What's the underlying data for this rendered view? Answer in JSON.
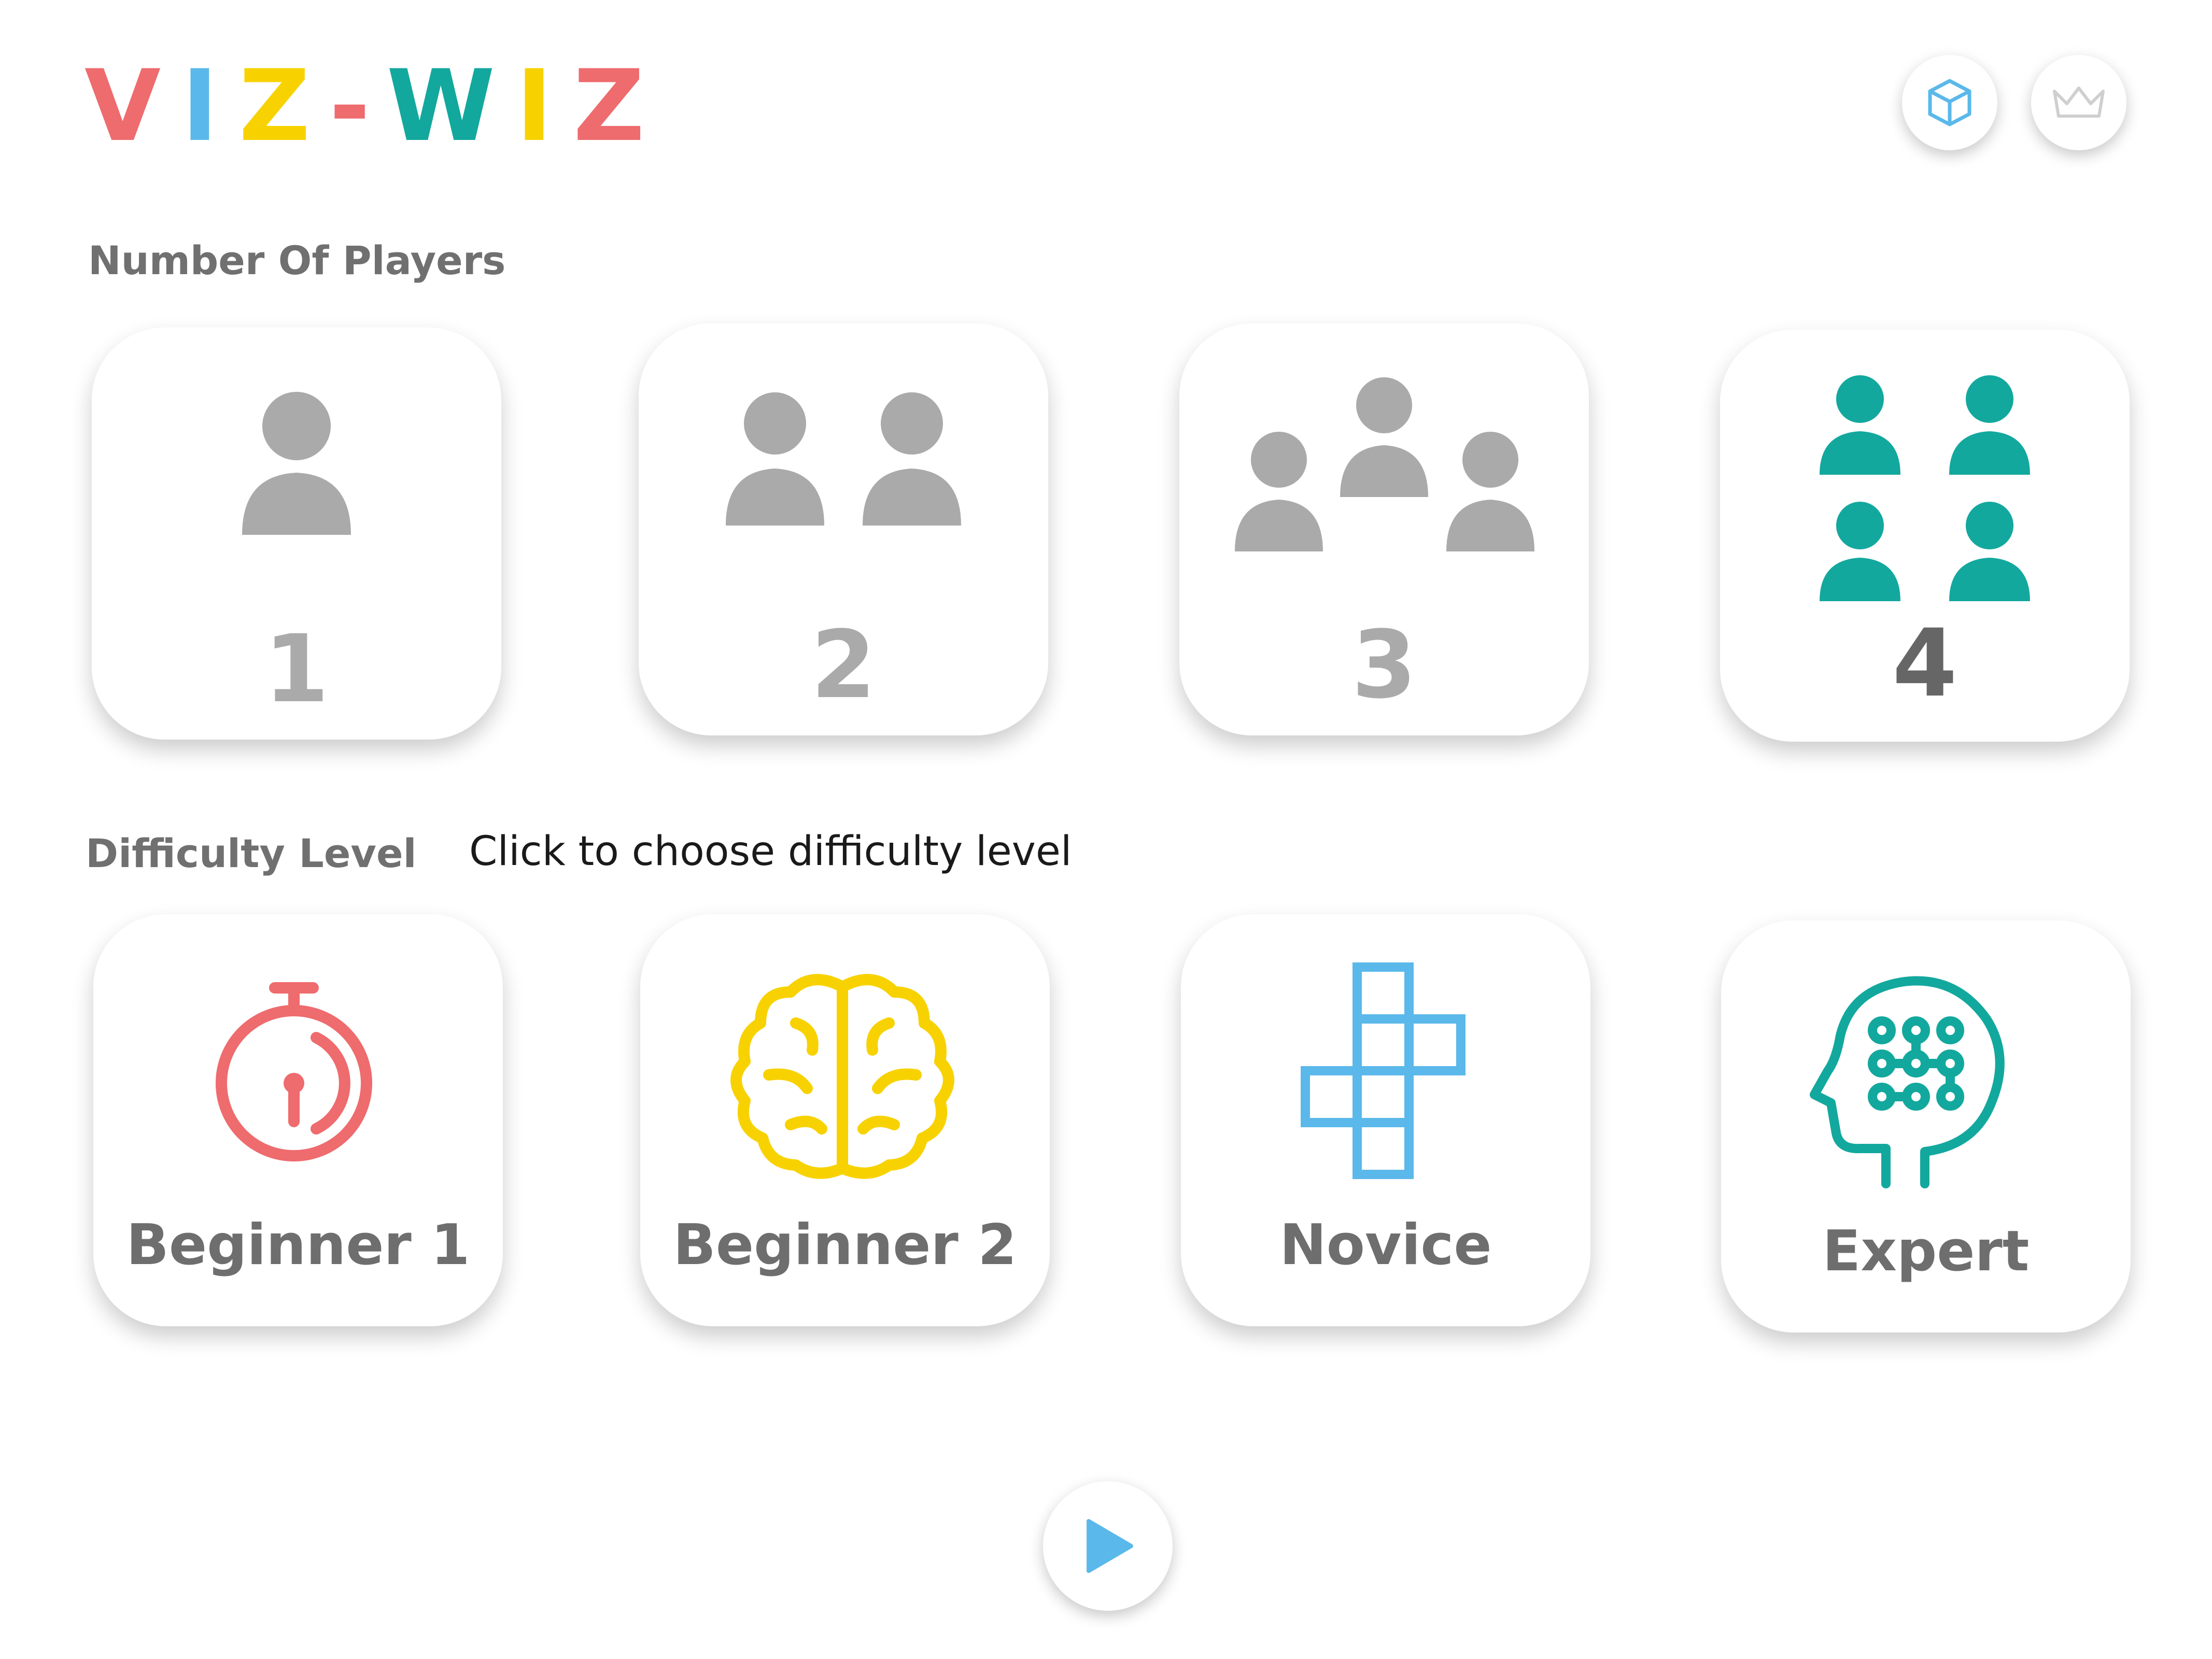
{
  "app": {
    "logo_letters": [
      "V",
      "I",
      "Z",
      "-",
      "W",
      "I",
      "Z"
    ],
    "logo_colors": [
      "#ee6b6e",
      "#5bb8ea",
      "#f7d200",
      "#ee6b6e",
      "#13a89e",
      "#f7d200",
      "#ee6b6e"
    ]
  },
  "header": {
    "cube_icon": "cube-icon",
    "crown_icon": "crown-icon"
  },
  "players": {
    "section_label": "Number Of Players",
    "options": [
      {
        "label": "1",
        "icon": "one-person-icon",
        "selected": false
      },
      {
        "label": "2",
        "icon": "two-people-icon",
        "selected": false
      },
      {
        "label": "3",
        "icon": "three-people-icon",
        "selected": false
      },
      {
        "label": "4",
        "icon": "four-people-icon",
        "selected": true
      }
    ]
  },
  "difficulty": {
    "section_label": "Difficulty Level",
    "hint": "Click to choose difficulty level",
    "options": [
      {
        "label": "Beginner 1",
        "icon": "stopwatch-icon",
        "color": "#ee6b6e"
      },
      {
        "label": "Beginner 2",
        "icon": "brain-icon",
        "color": "#f7d200"
      },
      {
        "label": "Novice",
        "icon": "cross-grid-icon",
        "color": "#5bb8ea"
      },
      {
        "label": "Expert",
        "icon": "head-circuit-icon",
        "color": "#13a89e"
      }
    ]
  },
  "play": {
    "icon": "play-icon",
    "color": "#5bb8ea"
  },
  "colors": {
    "inactive": "#aaaaaa",
    "selected_icon": "#13a89e",
    "selected_text": "#666666"
  }
}
